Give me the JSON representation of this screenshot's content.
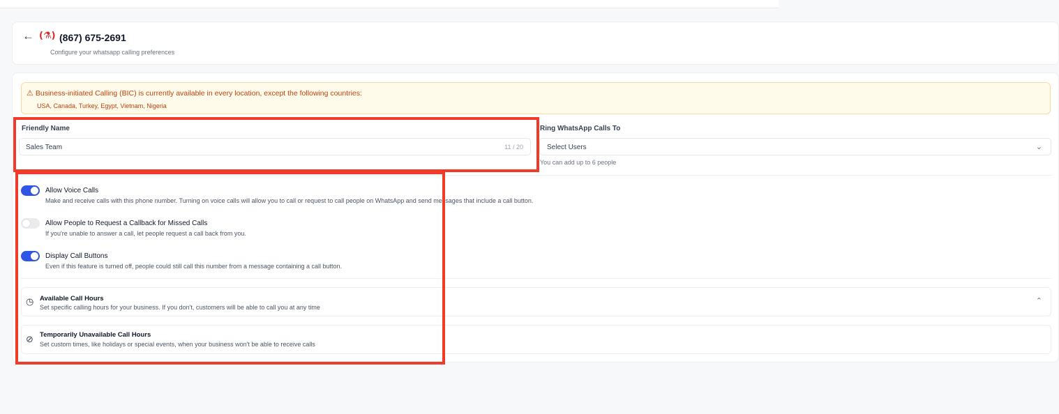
{
  "header": {
    "back_icon": "arrow-left-icon",
    "flag_text": "(❦)",
    "phone": "(867) 675-2691",
    "subtitle": "Configure your whatsapp calling preferences"
  },
  "banner": {
    "warning_icon": "⚠",
    "title": "Business-initiated Calling (BIC) is currently available in every location, except the following countries:",
    "countries": "USA, Canada, Turkey, Egypt, Vietnam, Nigeria",
    "color": "#c2410c"
  },
  "friendly_name": {
    "label": "Friendly Name",
    "value": "Sales Team",
    "counter": "11 / 20"
  },
  "ring_calls": {
    "label": "Ring WhatsApp Calls To",
    "placeholder": "Select Users",
    "hint": "You can add up to 6 people"
  },
  "options": [
    {
      "title": "Allow Voice Calls",
      "description": "Make and receive calls with this phone number. Turning on voice calls will allow you to call or request to call people on WhatsApp and send messages that include a call button.",
      "enabled": true
    },
    {
      "title": "Allow People to Request a Callback for Missed Calls",
      "description": "If you're unable to answer a call, let people request a call back from you.",
      "enabled": false
    },
    {
      "title": "Display Call Buttons",
      "description": "Even if this feature is turned off, people could still call this number from a message containing a call button.",
      "enabled": true
    }
  ],
  "sections": [
    {
      "icon": "clock-icon",
      "title": "Available Call Hours",
      "description": "Set specific calling hours for your business. If you don't, customers will be able to call you at any time"
    },
    {
      "icon": "prohibited-icon",
      "title": "Temporarily Unavailable Call Hours",
      "description": "Set custom times, like holidays or special events, when your business won't be able to receive calls"
    }
  ],
  "colors": {
    "toggle_on": "#2f55e6",
    "highlight": "#ef3b2a"
  }
}
